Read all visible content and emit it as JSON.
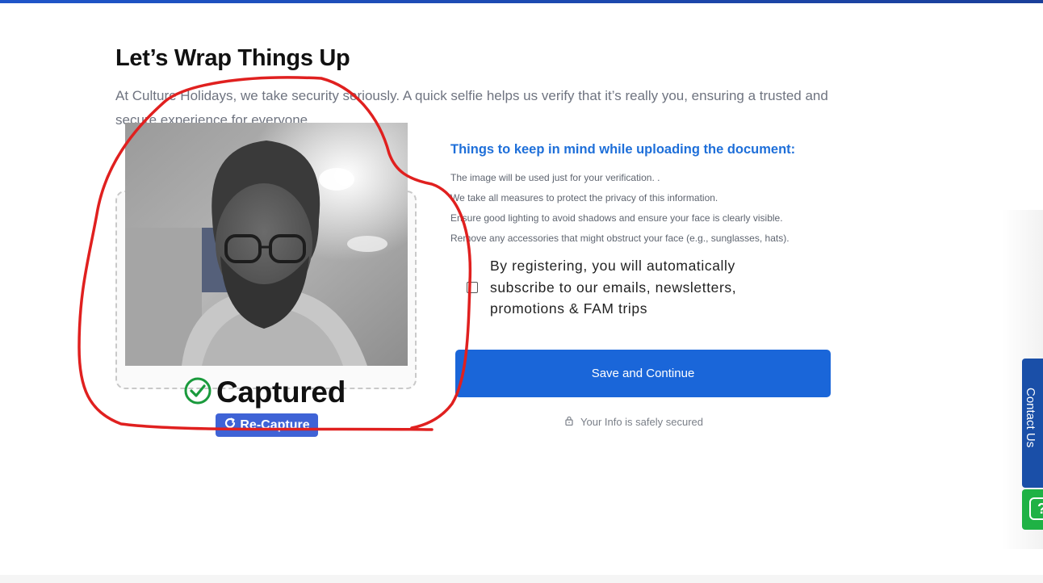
{
  "page": {
    "title": "Let’s Wrap Things Up",
    "intro": "At Culture Holidays, we take security seriously. A quick selfie helps us verify that it’s really you, ensuring a trusted and secure experience for everyone"
  },
  "capture": {
    "status_label": "Captured",
    "recapture_label": "Re-Capture",
    "status_icon": "check-circle-icon",
    "recapture_icon": "refresh-icon"
  },
  "guidelines": {
    "title": "Things to keep in mind while uploading the document:",
    "items": [
      "The image will be used just for your verification. .",
      "We take all measures to protect the privacy of this information.",
      "Ensure good lighting to avoid shadows and ensure your face is clearly visible.",
      "Remove any accessories that might obstruct your face (e.g., sunglasses, hats)."
    ]
  },
  "consent": {
    "text": "By registering, you will automatically subscribe to our emails, newsletters, promotions & FAM trips",
    "checked": false
  },
  "actions": {
    "save_label": "Save and Continue",
    "secure_note": "Your Info is safely secured",
    "secure_icon": "lock-icon"
  },
  "side_tabs": {
    "contact_label": "Contact Us",
    "help_icon": "question-icon"
  },
  "colors": {
    "accent": "#1a66d9",
    "guide_title": "#1e6fd9",
    "recapture_bg": "#3f63d6",
    "success": "#1a9a3c",
    "annotation": "#e0201f",
    "contact_tab": "#1a4fa8",
    "help_tab": "#1fb245"
  }
}
